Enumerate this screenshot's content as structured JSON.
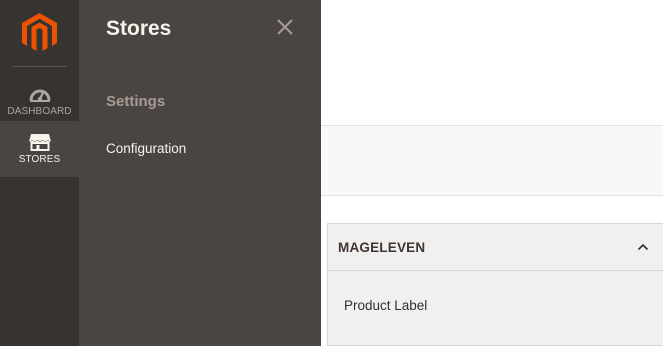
{
  "nav": {
    "items": [
      {
        "label": "DASHBOARD",
        "icon": "dashboard-icon",
        "active": false
      },
      {
        "label": "STORES",
        "icon": "store-icon",
        "active": true
      }
    ],
    "logo": "magento-logo",
    "brand_color": "#eb5202"
  },
  "submenu": {
    "title": "Stores",
    "close_icon": "close-icon",
    "section_title": "Settings",
    "links": [
      {
        "label": "Configuration"
      }
    ]
  },
  "config": {
    "group_title": "MAGELEVEN",
    "group_icon": "chevron-up-icon",
    "items": [
      {
        "label": "Product Label"
      }
    ]
  }
}
